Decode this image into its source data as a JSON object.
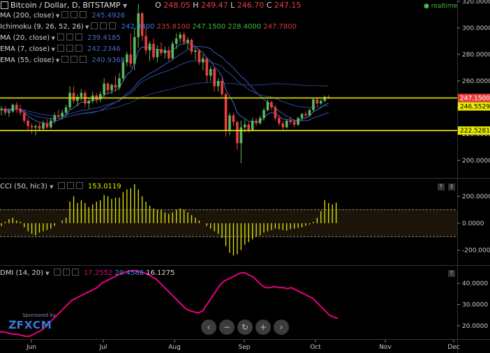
{
  "header": {
    "symbol": "Bitcoin / Dollar, D, BITSTAMP",
    "o_label": "O",
    "o_value": "248.05",
    "h_label": "H",
    "h_value": "249.47",
    "l_label": "L",
    "l_value": "246.70",
    "c_label": "C",
    "c_value": "247.15",
    "realtime": "realtime"
  },
  "indicators": [
    {
      "label": "MA (200, close)",
      "values": [
        "245.4926"
      ],
      "colors": [
        "#4a6ac8"
      ]
    },
    {
      "label": "Ichimoku (9, 26, 52, 26)",
      "values": [
        "242.3400",
        "235.8100",
        "247.1500",
        "228.4000",
        "247.7800"
      ],
      "colors": [
        "#3a78e8",
        "#d23a3a",
        "#38c038",
        "#38c038",
        "#d23a3a"
      ]
    },
    {
      "label": "MA (20, close)",
      "values": [
        "239.4185"
      ],
      "colors": [
        "#4a6ac8"
      ]
    },
    {
      "label": "EMA (7, close)",
      "values": [
        "242.2346"
      ],
      "colors": [
        "#4a6ac8"
      ]
    },
    {
      "label": "EMA (55, close)",
      "values": [
        "240.9368"
      ],
      "colors": [
        "#4a6ac8"
      ]
    }
  ],
  "cci": {
    "label": "CCI (50, hlc3)",
    "value": "153.0119",
    "value_color": "#e8e800"
  },
  "dmi": {
    "label": "DMI (14, 20)",
    "values": [
      "17.2552",
      "20.4588",
      "16.1275"
    ],
    "colors": [
      "#e8007e",
      "#4a8ae8",
      "#d8d8d8"
    ]
  },
  "sponsor": {
    "text": "Sponsored by",
    "brand": "FXCM"
  },
  "nav_buttons": [
    {
      "name": "scroll-left-button",
      "glyph": "‹"
    },
    {
      "name": "zoom-out-button",
      "glyph": "−"
    },
    {
      "name": "reset-button",
      "glyph": "↻"
    },
    {
      "name": "zoom-in-button",
      "glyph": "+"
    },
    {
      "name": "scroll-right-button",
      "glyph": "›"
    }
  ],
  "colors": {
    "up": "#5cb85c",
    "down": "#e84040",
    "hline": "#e8e800",
    "cci": "#e8e800",
    "dmi": "#e8007e"
  },
  "chart_data": [
    {
      "type": "candlestick",
      "title": "Bitcoin / Dollar, D, BITSTAMP",
      "x_ticks": [
        "Jun",
        "Jul",
        "Aug",
        "Sep",
        "Oct",
        "Nov",
        "Dec"
      ],
      "y_ticks": [
        200,
        220,
        240,
        260,
        280,
        300,
        320
      ],
      "ylim": [
        190,
        320
      ],
      "price_labels": [
        "247.1500",
        "246.5529",
        "222.5281"
      ],
      "horizontal_levels": [
        247.15,
        222.53
      ],
      "ohlc": [
        [
          238,
          241,
          234,
          239
        ],
        [
          239,
          241,
          234,
          236
        ],
        [
          236,
          239,
          233,
          237
        ],
        [
          237,
          243,
          236,
          242
        ],
        [
          242,
          244,
          236,
          239
        ],
        [
          239,
          242,
          234,
          236
        ],
        [
          236,
          238,
          228,
          230
        ],
        [
          230,
          232,
          223,
          226
        ],
        [
          226,
          228,
          220,
          225
        ],
        [
          225,
          227,
          219,
          226
        ],
        [
          226,
          228,
          222,
          224
        ],
        [
          224,
          230,
          223,
          228
        ],
        [
          228,
          231,
          224,
          225
        ],
        [
          225,
          232,
          224,
          230
        ],
        [
          230,
          236,
          228,
          234
        ],
        [
          234,
          238,
          232,
          233
        ],
        [
          233,
          238,
          231,
          236
        ],
        [
          236,
          242,
          234,
          240
        ],
        [
          240,
          256,
          238,
          251
        ],
        [
          251,
          256,
          243,
          245
        ],
        [
          245,
          250,
          241,
          248
        ],
        [
          248,
          254,
          245,
          251
        ],
        [
          251,
          253,
          240,
          243
        ],
        [
          243,
          247,
          239,
          245
        ],
        [
          245,
          252,
          243,
          249
        ],
        [
          249,
          251,
          243,
          246
        ],
        [
          246,
          252,
          244,
          250
        ],
        [
          250,
          262,
          248,
          258
        ],
        [
          258,
          259,
          250,
          253
        ],
        [
          253,
          258,
          250,
          257
        ],
        [
          257,
          264,
          252,
          255
        ],
        [
          255,
          266,
          253,
          262
        ],
        [
          262,
          276,
          260,
          274
        ],
        [
          274,
          282,
          271,
          280
        ],
        [
          280,
          296,
          270,
          273
        ],
        [
          273,
          300,
          268,
          293
        ],
        [
          293,
          318,
          285,
          311
        ],
        [
          311,
          312,
          290,
          294
        ],
        [
          294,
          300,
          280,
          283
        ],
        [
          283,
          290,
          275,
          288
        ],
        [
          288,
          292,
          276,
          278
        ],
        [
          278,
          287,
          274,
          284
        ],
        [
          284,
          289,
          279,
          281
        ],
        [
          281,
          286,
          277,
          283
        ],
        [
          283,
          286,
          275,
          277
        ],
        [
          277,
          290,
          276,
          288
        ],
        [
          288,
          296,
          284,
          292
        ],
        [
          292,
          297,
          289,
          295
        ],
        [
          295,
          297,
          287,
          289
        ],
        [
          289,
          293,
          284,
          291
        ],
        [
          291,
          292,
          280,
          282
        ],
        [
          282,
          285,
          276,
          283
        ],
        [
          283,
          284,
          272,
          274
        ],
        [
          274,
          280,
          268,
          277
        ],
        [
          277,
          278,
          259,
          264
        ],
        [
          264,
          271,
          260,
          269
        ],
        [
          269,
          270,
          252,
          256
        ],
        [
          256,
          262,
          252,
          260
        ],
        [
          260,
          262,
          248,
          250
        ],
        [
          250,
          251,
          218,
          223
        ],
        [
          223,
          236,
          219,
          234
        ],
        [
          234,
          236,
          226,
          229
        ],
        [
          229,
          230,
          208,
          213
        ],
        [
          213,
          230,
          198,
          225
        ],
        [
          225,
          231,
          221,
          227
        ],
        [
          227,
          229,
          221,
          223
        ],
        [
          223,
          232,
          222,
          230
        ],
        [
          230,
          232,
          226,
          228
        ],
        [
          228,
          234,
          227,
          232
        ],
        [
          232,
          240,
          230,
          238
        ],
        [
          238,
          246,
          237,
          244
        ],
        [
          244,
          245,
          238,
          240
        ],
        [
          240,
          242,
          230,
          232
        ],
        [
          232,
          234,
          226,
          228
        ],
        [
          228,
          230,
          223,
          225
        ],
        [
          225,
          231,
          224,
          230
        ],
        [
          230,
          233,
          227,
          229
        ],
        [
          229,
          231,
          225,
          227
        ],
        [
          227,
          233,
          226,
          232
        ],
        [
          232,
          236,
          230,
          235
        ],
        [
          235,
          237,
          232,
          234
        ],
        [
          234,
          239,
          233,
          238
        ],
        [
          238,
          247,
          237,
          246
        ],
        [
          246,
          247,
          241,
          243
        ],
        [
          243,
          246,
          242,
          245
        ],
        [
          245,
          249,
          244,
          248
        ],
        [
          248,
          249.47,
          246.7,
          247.15
        ]
      ],
      "series": [
        {
          "name": "MA (200, close)",
          "color": "#4a6ac8"
        },
        {
          "name": "MA (20, close)",
          "color": "#4a6ac8"
        },
        {
          "name": "EMA (7, close)",
          "color": "#4a6ac8"
        },
        {
          "name": "EMA (55, close)",
          "color": "#4a6ac8"
        }
      ]
    },
    {
      "type": "bar",
      "title": "CCI (50, hlc3)",
      "y_ticks": [
        200,
        0,
        -200
      ],
      "ylim": [
        -280,
        300
      ],
      "levels": [
        100,
        -100
      ],
      "values": [
        -20,
        10,
        30,
        40,
        20,
        10,
        -30,
        -60,
        -80,
        -90,
        -70,
        -60,
        -50,
        -40,
        -20,
        0,
        20,
        40,
        160,
        200,
        150,
        170,
        150,
        120,
        140,
        160,
        170,
        210,
        200,
        180,
        190,
        190,
        230,
        250,
        260,
        290,
        250,
        200,
        160,
        130,
        110,
        100,
        100,
        80,
        70,
        80,
        100,
        110,
        100,
        80,
        60,
        40,
        20,
        0,
        -20,
        -40,
        -60,
        -80,
        -110,
        -170,
        -220,
        -240,
        -230,
        -200,
        -160,
        -140,
        -120,
        -100,
        -90,
        -70,
        -60,
        -50,
        -40,
        -45,
        -50,
        -55,
        -45,
        -40,
        -35,
        -30,
        -20,
        -10,
        10,
        40,
        90,
        170,
        150,
        140,
        153
      ]
    },
    {
      "type": "line",
      "title": "DMI (14, 20)",
      "y_ticks": [
        40,
        30,
        20
      ],
      "ylim": [
        15,
        47
      ],
      "series": [
        {
          "name": "DMI (14, 20)",
          "color": "#e8007e",
          "values": [
            17,
            17,
            16.5,
            16,
            16,
            15.5,
            15,
            15,
            16,
            17,
            18,
            20,
            22,
            24,
            26,
            28,
            30,
            32,
            33,
            34,
            35,
            36,
            37,
            38,
            40,
            41,
            42,
            43,
            44,
            45,
            45.5,
            46,
            46,
            45.5,
            45,
            44.5,
            43,
            42,
            40,
            38,
            36,
            34,
            32,
            30,
            28,
            27,
            26.5,
            26,
            27,
            30,
            33,
            36,
            39,
            41,
            42,
            43,
            44,
            45,
            45,
            44,
            43,
            41,
            39,
            38,
            38,
            38.5,
            38,
            38,
            37.5,
            38,
            37,
            36,
            35,
            34,
            33,
            31,
            29,
            27,
            25,
            24,
            23.5
          ]
        }
      ]
    }
  ]
}
